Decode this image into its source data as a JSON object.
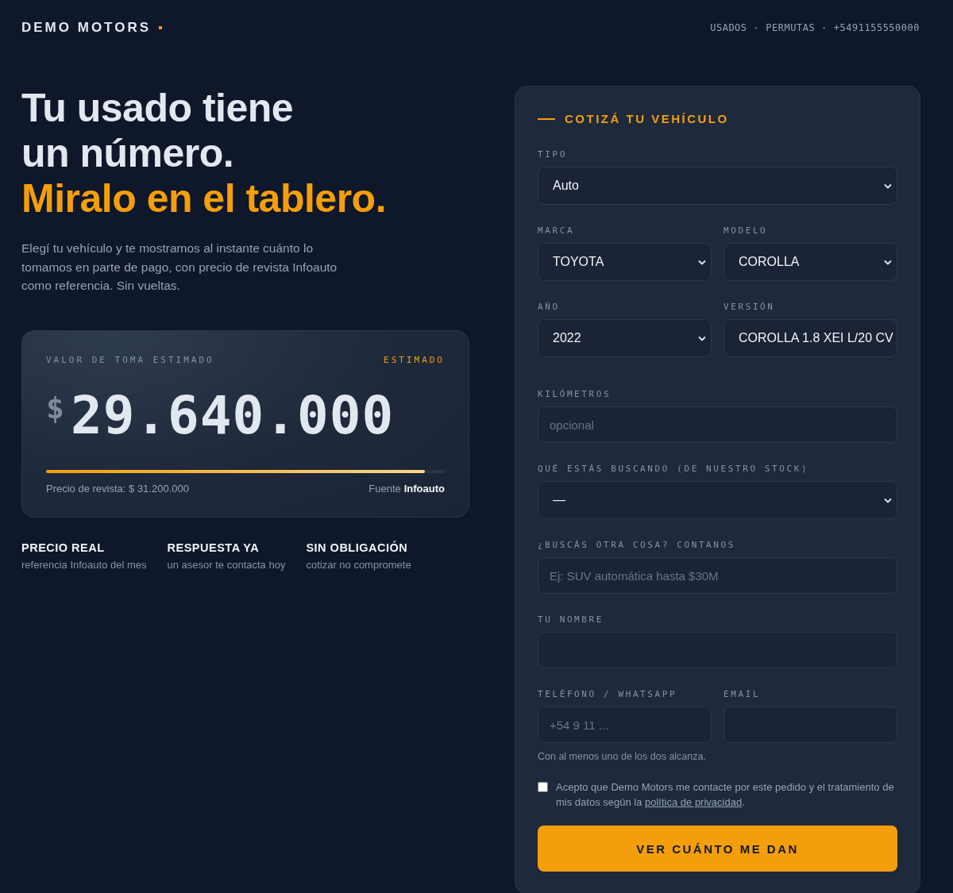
{
  "header": {
    "brand": "DEMO MOTORS",
    "nav": [
      "USADOS",
      "PERMUTAS",
      "+5491155550000"
    ],
    "separator": "·"
  },
  "hero": {
    "title_lines": [
      "Tu usado tiene",
      "un número."
    ],
    "highlight": "Miralo en el tablero.",
    "description": "Elegí tu vehículo y te mostramos al instante cuánto lo tomamos en parte de pago, con precio de revista Infoauto como referencia. Sin vueltas."
  },
  "estimate": {
    "label": "VALOR DE TOMA ESTIMADO",
    "badge": "ESTIMADO",
    "currency": "$",
    "amount": "29.640.000",
    "level": 0.95,
    "reference": "Precio de revista: $ 31.200.000",
    "source_label": "Fuente",
    "source": "Infoauto"
  },
  "features": [
    {
      "title": "PRECIO REAL",
      "text": "referencia Infoauto del mes"
    },
    {
      "title": "RESPUESTA YA",
      "text": "un asesor te contacta hoy"
    },
    {
      "title": "SIN OBLIGACIÓN",
      "text": "cotizar no compromete"
    }
  ],
  "form": {
    "title": "COTIZÁ TU VEHÍCULO",
    "vehicle_rows": [
      [
        {
          "kind": "select",
          "label": "TIPO",
          "value": "Auto"
        }
      ],
      [
        {
          "kind": "select",
          "label": "MARCA",
          "value": "TOYOTA"
        },
        {
          "kind": "select",
          "label": "MODELO",
          "value": "COROLLA"
        }
      ],
      [
        {
          "kind": "select",
          "label": "AÑO",
          "value": "2022"
        },
        {
          "kind": "select",
          "label": "VERSIÓN",
          "value": "COROLLA 1.8 XEI L/20 CV"
        }
      ]
    ],
    "contact_rows": [
      [
        {
          "kind": "input",
          "label": "KILÓMETROS",
          "placeholder": "opcional"
        }
      ],
      [
        {
          "kind": "select",
          "label": "QUÉ ESTÁS BUSCANDO (DE NUESTRO STOCK)",
          "value": "—"
        }
      ],
      [
        {
          "kind": "input",
          "label": "¿BUSCÁS OTRA COSA? CONTANOS",
          "placeholder": "Ej: SUV automática hasta $30M"
        }
      ],
      [
        {
          "kind": "input",
          "label": "TU NOMBRE"
        }
      ],
      [
        {
          "kind": "input",
          "label": "TELÉFONO / WHATSAPP",
          "placeholder": "+54 9 11 ..."
        },
        {
          "kind": "input",
          "label": "EMAIL"
        }
      ]
    ],
    "hint": "Con al menos uno de los dos alcanza.",
    "consent": {
      "checked": false,
      "text": "Acepto que Demo Motors me contacte por este pedido y el tratamiento de mis datos según la ",
      "link": "política de privacidad",
      "after": "."
    },
    "submit": "VER CUÁNTO ME DAN"
  }
}
